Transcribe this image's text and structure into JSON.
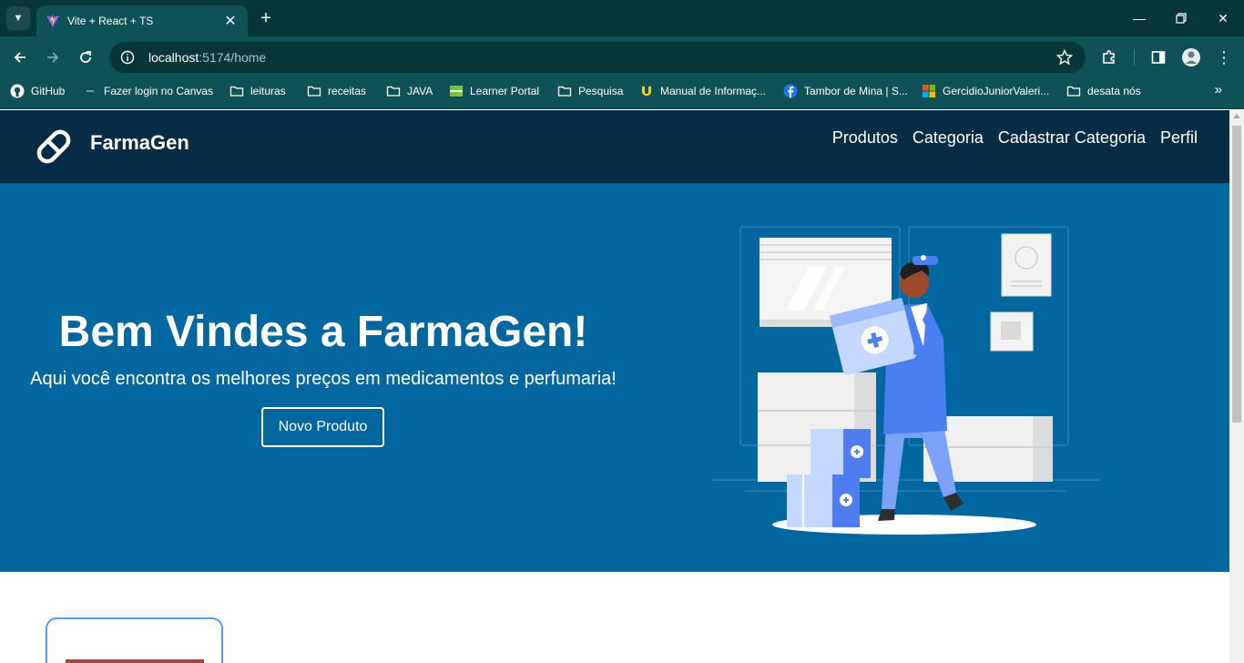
{
  "browser": {
    "tab_title": "Vite + React + TS",
    "url_host": "localhost",
    "url_path": ":5174/home",
    "bookmarks": [
      {
        "label": "GitHub",
        "icon": "github-icon"
      },
      {
        "label": "Fazer login no Canvas",
        "icon": "canvas-icon"
      },
      {
        "label": "leituras",
        "icon": "folder-icon"
      },
      {
        "label": "receitas",
        "icon": "folder-icon"
      },
      {
        "label": "JAVA",
        "icon": "folder-icon"
      },
      {
        "label": "Learner Portal",
        "icon": "learner-portal-icon"
      },
      {
        "label": "Pesquisa",
        "icon": "folder-icon"
      },
      {
        "label": "Manual de Informaç...",
        "icon": "u-logo-icon"
      },
      {
        "label": "Tambor de Mina | S...",
        "icon": "facebook-icon"
      },
      {
        "label": "GercidioJuniorValeri...",
        "icon": "microsoft-icon"
      },
      {
        "label": "desata nós",
        "icon": "folder-icon"
      }
    ]
  },
  "site": {
    "brand": "FarmaGen",
    "nav": [
      "Produtos",
      "Categoria",
      "Cadastrar Categoria",
      "Perfil"
    ]
  },
  "hero": {
    "title": "Bem Vindes a FarmaGen!",
    "subtitle": "Aqui você encontra os melhores preços em medicamentos e perfumaria!",
    "button": "Novo Produto"
  },
  "colors": {
    "nav_bg": "#072c45",
    "hero_bg": "#02669f",
    "browser_tabbar": "#06363a",
    "browser_toolbar": "#0f5156",
    "card_border": "#5a9be0"
  }
}
